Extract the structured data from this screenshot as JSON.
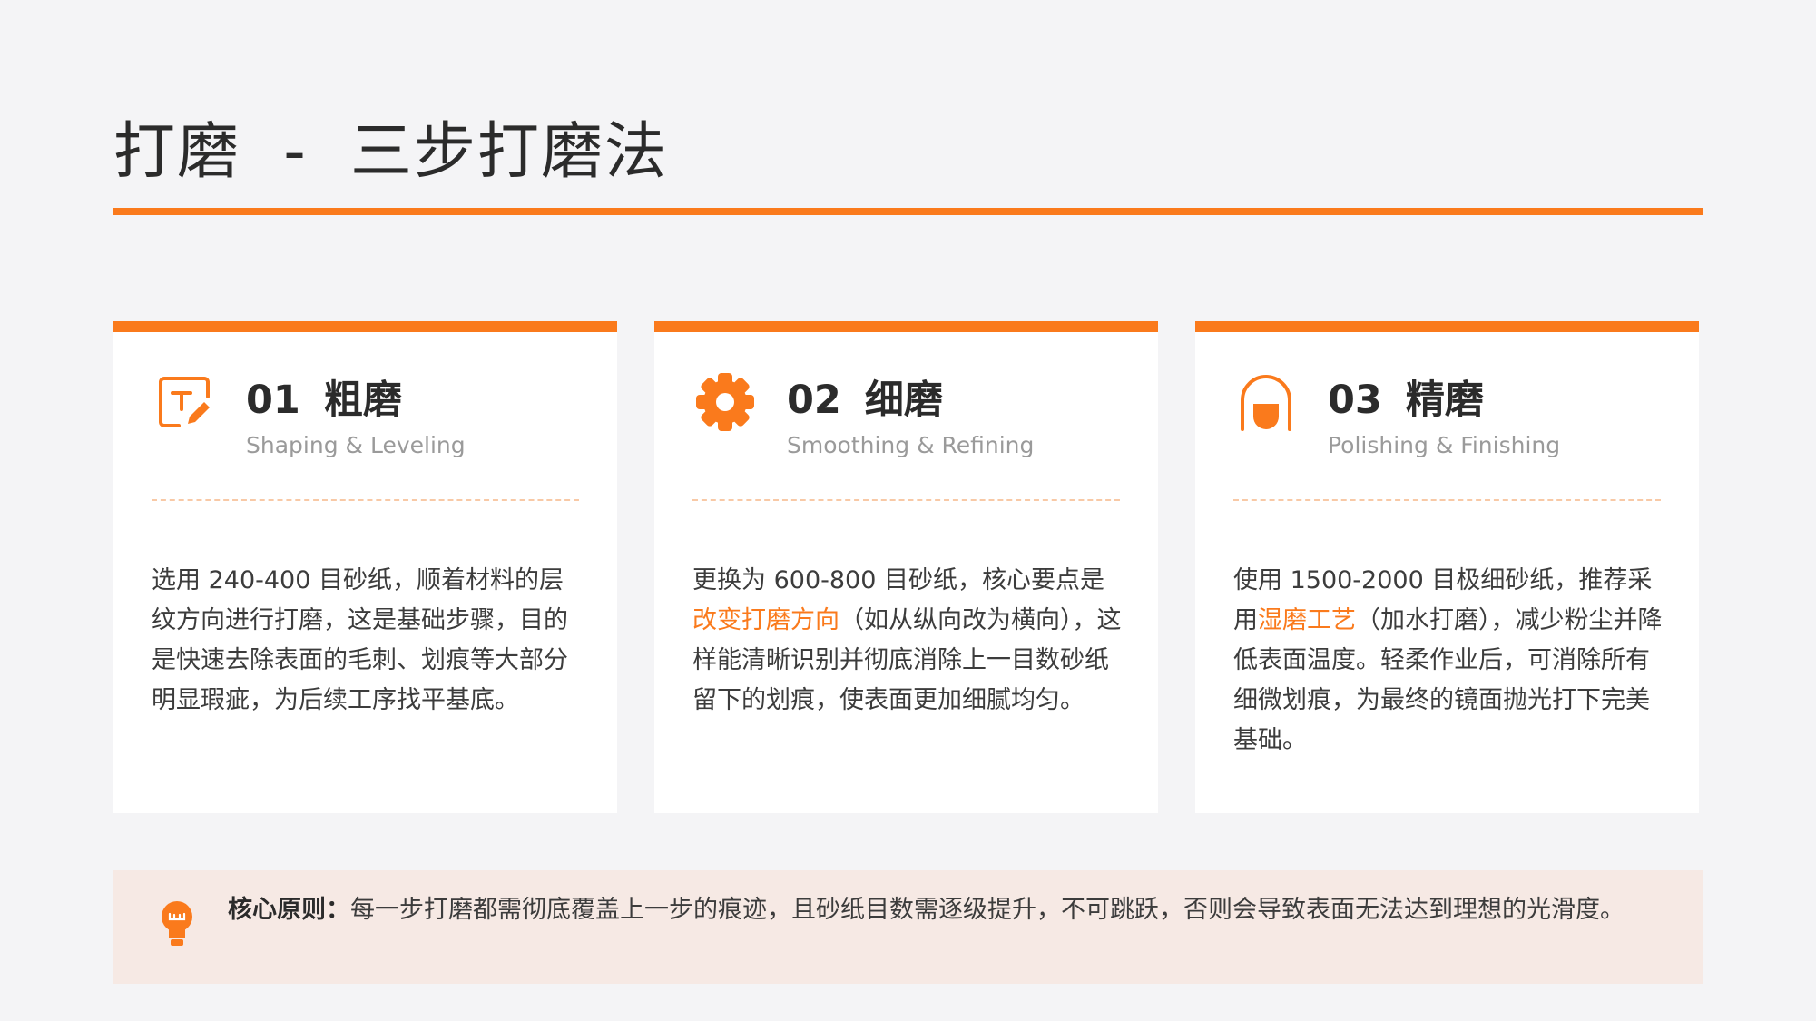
{
  "page": {
    "title": "打磨  -  三步打磨法"
  },
  "colors": {
    "accent": "#fa7a1c",
    "background": "#f4f4f6",
    "card": "#ffffff",
    "callout": "#f6e9e4"
  },
  "cards": [
    {
      "number": "01",
      "name": "粗磨",
      "subtitle": "Shaping & Leveling",
      "icon": "text-edit-icon",
      "body_pre": "选用 240-400 目砂纸，顺着材料的层纹方向进行打磨，这是基础步骤，目的是快速去除表面的毛刺、划痕等大部分明显瑕疵，为后续工序找平基底。",
      "highlight": "",
      "body_post": ""
    },
    {
      "number": "02",
      "name": "细磨",
      "subtitle": "Smoothing & Refining",
      "icon": "gear-icon",
      "body_pre": "更换为 600-800 目砂纸，核心要点是",
      "highlight": "改变打磨方向",
      "body_post": "（如从纵向改为横向），这样能清晰识别并彻底消除上一目数砂纸留下的划痕，使表面更加细腻均匀。"
    },
    {
      "number": "03",
      "name": "精磨",
      "subtitle": "Polishing & Finishing",
      "icon": "polish-bell-icon",
      "body_pre": "使用 1500-2000 目极细砂纸，推荐采用",
      "highlight": "湿磨工艺",
      "body_post": "（加水打磨），减少粉尘并降低表面温度。轻柔作业后，可消除所有细微划痕，为最终的镜面抛光打下完美基础。"
    }
  ],
  "core": {
    "icon": "lightbulb-icon",
    "label": "核心原则：",
    "text": "每一步打磨都需彻底覆盖上一步的痕迹，且砂纸目数需逐级提升，不可跳跃，否则会导致表面无法达到理想的光滑度。"
  }
}
